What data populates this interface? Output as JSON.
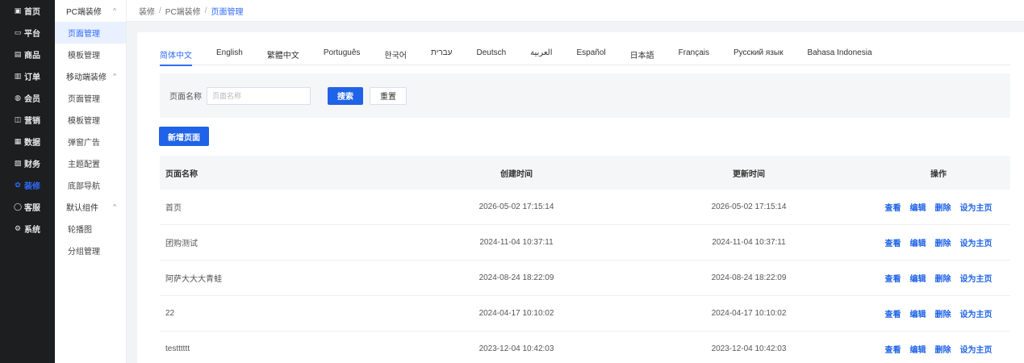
{
  "main_nav": [
    {
      "icon": "home-icon",
      "glyph": "▣",
      "label": "首页",
      "active": false
    },
    {
      "icon": "platform-icon",
      "glyph": "▭",
      "label": "平台",
      "active": false
    },
    {
      "icon": "goods-icon",
      "glyph": "▤",
      "label": "商品",
      "active": false
    },
    {
      "icon": "order-icon",
      "glyph": "▥",
      "label": "订单",
      "active": false
    },
    {
      "icon": "member-icon",
      "glyph": "◍",
      "label": "会员",
      "active": false
    },
    {
      "icon": "marketing-icon",
      "glyph": "◫",
      "label": "营销",
      "active": false
    },
    {
      "icon": "data-icon",
      "glyph": "▦",
      "label": "数据",
      "active": false
    },
    {
      "icon": "finance-icon",
      "glyph": "▧",
      "label": "财务",
      "active": false
    },
    {
      "icon": "decoration-icon",
      "glyph": "✿",
      "label": "装修",
      "active": true
    },
    {
      "icon": "service-icon",
      "glyph": "◯",
      "label": "客服",
      "active": false
    },
    {
      "icon": "system-icon",
      "glyph": "⚙",
      "label": "系统",
      "active": false
    }
  ],
  "sub_nav": [
    {
      "type": "group",
      "label": "PC端装修",
      "chevron": "^"
    },
    {
      "type": "item",
      "label": "页面管理",
      "active": true
    },
    {
      "type": "item",
      "label": "模板管理",
      "active": false
    },
    {
      "type": "group",
      "label": "移动端装修",
      "chevron": "^"
    },
    {
      "type": "item",
      "label": "页面管理",
      "active": false
    },
    {
      "type": "item",
      "label": "模板管理",
      "active": false
    },
    {
      "type": "item",
      "label": "弹窗广告",
      "active": false
    },
    {
      "type": "item",
      "label": "主题配置",
      "active": false
    },
    {
      "type": "item",
      "label": "底部导航",
      "active": false
    },
    {
      "type": "group",
      "label": "默认组件",
      "chevron": "^"
    },
    {
      "type": "item",
      "label": "轮播图",
      "active": false
    },
    {
      "type": "item",
      "label": "分组管理",
      "active": false
    }
  ],
  "breadcrumb": {
    "items": [
      "装修",
      "PC端装修"
    ],
    "current": "页面管理",
    "separator": "/"
  },
  "language_tabs": [
    "简体中文",
    "English",
    "繁體中文",
    "Português",
    "한국어",
    "עברית",
    "Deutsch",
    "العربية",
    "Español",
    "日本語",
    "Français",
    "Русский язык",
    "Bahasa Indonesia"
  ],
  "active_tab_index": 0,
  "filter": {
    "label": "页面名称",
    "placeholder": "页面名称",
    "value": "",
    "search_label": "搜索",
    "reset_label": "重置"
  },
  "add_button_label": "新增页面",
  "table": {
    "headers": [
      "页面名称",
      "创建时间",
      "更新时间",
      "操作"
    ],
    "rows": [
      {
        "name": "首页",
        "created": "2026-05-02 17:15:14",
        "updated": "2026-05-02 17:15:14"
      },
      {
        "name": "团购测试",
        "created": "2024-11-04 10:37:11",
        "updated": "2024-11-04 10:37:11"
      },
      {
        "name": "阿萨大大大青蛙",
        "created": "2024-08-24 18:22:09",
        "updated": "2024-08-24 18:22:09"
      },
      {
        "name": "22",
        "created": "2024-04-17 10:10:02",
        "updated": "2024-04-17 10:10:02"
      },
      {
        "name": "testttttt",
        "created": "2023-12-04 10:42:03",
        "updated": "2023-12-04 10:42:03"
      }
    ],
    "actions": [
      "查看",
      "编辑",
      "删除",
      "设为主页"
    ]
  },
  "colors": {
    "accent": "#2f6bff",
    "primary_button": "#1f63e8",
    "nav_bg": "#1d1e20"
  }
}
